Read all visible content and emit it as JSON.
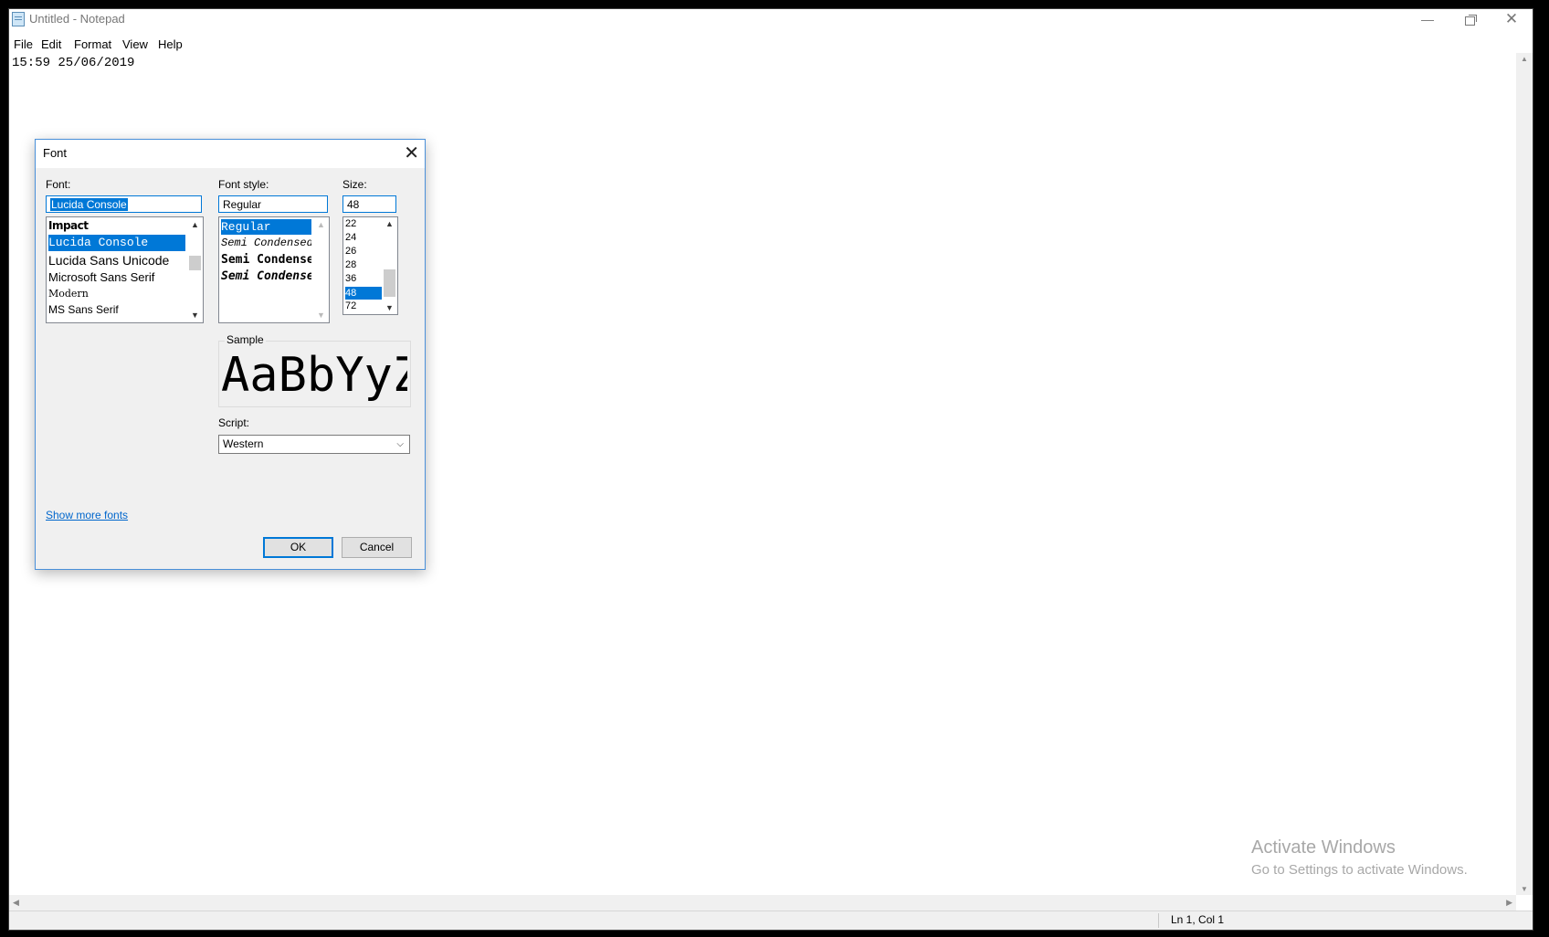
{
  "window": {
    "title": "Untitled - Notepad",
    "min_glyph": "—",
    "close_glyph": "✕"
  },
  "menu": [
    "File",
    "Edit",
    "Format",
    "View",
    "Help"
  ],
  "editor": {
    "content": "15:59 25/06/2019"
  },
  "status": {
    "position": "Ln 1, Col 1"
  },
  "watermark": {
    "title": "Activate Windows",
    "subtitle": "Go to Settings to activate Windows."
  },
  "font_dialog": {
    "title": "Font",
    "close_glyph": "✕",
    "font_label": "Font:",
    "font_value": "Lucida Console",
    "font_list": [
      {
        "name": "Impact",
        "selected": false
      },
      {
        "name": "Lucida Console",
        "selected": true
      },
      {
        "name": "Lucida Sans Unicode",
        "selected": false
      },
      {
        "name": "Microsoft Sans Serif",
        "selected": false
      },
      {
        "name": "Modern",
        "selected": false
      },
      {
        "name": "MS Sans Serif",
        "selected": false
      }
    ],
    "style_label": "Font style:",
    "style_value": "Regular",
    "style_list": [
      {
        "name": "Regular",
        "selected": true
      },
      {
        "name": "Semi Condensed",
        "selected": false
      },
      {
        "name": "Semi Condensed",
        "selected": false
      },
      {
        "name": "Semi Condensed",
        "selected": false
      }
    ],
    "size_label": "Size:",
    "size_value": "48",
    "size_list": [
      {
        "name": "22",
        "selected": false
      },
      {
        "name": "24",
        "selected": false
      },
      {
        "name": "26",
        "selected": false
      },
      {
        "name": "28",
        "selected": false
      },
      {
        "name": "36",
        "selected": false
      },
      {
        "name": "48",
        "selected": true
      },
      {
        "name": "72",
        "selected": false
      }
    ],
    "sample_label": "Sample",
    "sample_text": "AaBbYyZz",
    "script_label": "Script:",
    "script_value": "Western",
    "more_fonts_link": "Show more fonts",
    "ok_label": "OK",
    "cancel_label": "Cancel"
  },
  "icons": {
    "up": "▲",
    "down": "▼",
    "left": "◀",
    "right": "▶",
    "dropdown": "⌵"
  }
}
